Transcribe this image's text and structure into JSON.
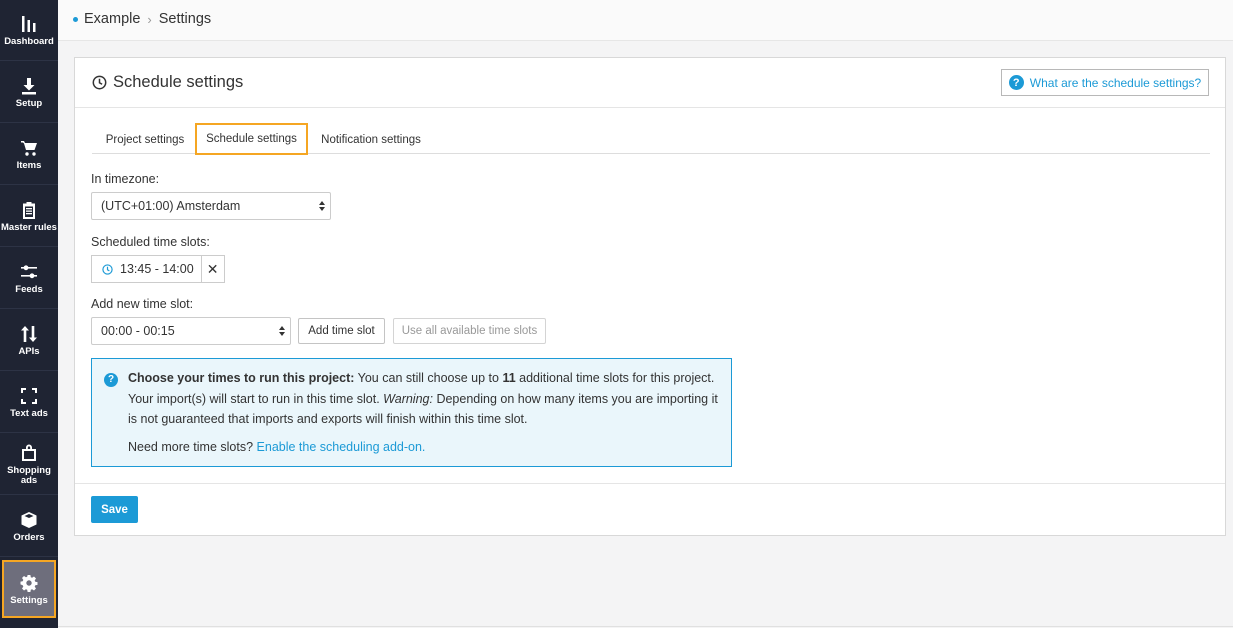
{
  "sidebar": {
    "items": [
      {
        "label": "Dashboard",
        "icon": "bar-chart-icon"
      },
      {
        "label": "Setup",
        "icon": "download-icon"
      },
      {
        "label": "Items",
        "icon": "cart-icon"
      },
      {
        "label": "Master rules",
        "icon": "clipboard-icon"
      },
      {
        "label": "Feeds",
        "icon": "sliders-icon"
      },
      {
        "label": "APIs",
        "icon": "arrows-updown-icon"
      },
      {
        "label": "Text ads",
        "icon": "expand-icon"
      },
      {
        "label": "Shopping ads",
        "icon": "bag-icon"
      },
      {
        "label": "Orders",
        "icon": "box-icon"
      },
      {
        "label": "Settings",
        "icon": "gear-icon",
        "active": true
      }
    ],
    "accent": "#f5a623"
  },
  "breadcrumb": {
    "project": "Example",
    "page": "Settings"
  },
  "panel": {
    "title": "Schedule settings",
    "help_label": "What are the schedule settings?"
  },
  "tabs": [
    {
      "label": "Project settings"
    },
    {
      "label": "Schedule settings",
      "active": true
    },
    {
      "label": "Notification settings"
    }
  ],
  "form": {
    "timezone_label": "In timezone:",
    "timezone_value": "(UTC+01:00) Amsterdam",
    "scheduled_label": "Scheduled time slots:",
    "slots": [
      "13:45 - 14:00"
    ],
    "add_label": "Add new time slot:",
    "new_slot_value": "00:00 - 00:15",
    "add_button": "Add time slot",
    "use_all_button": "Use all available time slots"
  },
  "info": {
    "bold_lead": "Choose your times to run this project:",
    "text1": " You can still choose up to ",
    "count": "11",
    "text2": " additional time slots for this project. Your import(s) will start to run in this time slot. ",
    "warning_label": "Warning:",
    "text3": " Depending on how many items you are importing it is not guaranteed that imports and exports will finish within this time slot.",
    "more_text": "Need more time slots? ",
    "more_link": "Enable the scheduling add-on."
  },
  "save_label": "Save",
  "colors": {
    "primary": "#1c9ad6",
    "sidebar_bg": "#1f2433",
    "highlight": "#f5a623"
  }
}
